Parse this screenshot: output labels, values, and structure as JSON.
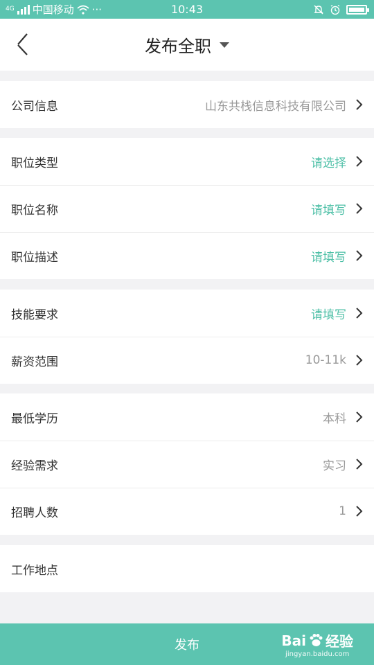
{
  "status": {
    "carrier": "中国移动",
    "network": "4G",
    "dots": "···",
    "time": "10:43"
  },
  "header": {
    "title": "发布全职"
  },
  "sections": [
    {
      "rows": [
        {
          "label": "公司信息",
          "value": "山东共栈信息科技有限公司",
          "accent": false
        }
      ]
    },
    {
      "rows": [
        {
          "label": "职位类型",
          "value": "请选择",
          "accent": true
        },
        {
          "label": "职位名称",
          "value": "请填写",
          "accent": true
        },
        {
          "label": "职位描述",
          "value": "请填写",
          "accent": true
        }
      ]
    },
    {
      "rows": [
        {
          "label": "技能要求",
          "value": "请填写",
          "accent": true
        },
        {
          "label": "薪资范围",
          "value": "10-11k",
          "accent": false
        }
      ]
    },
    {
      "rows": [
        {
          "label": "最低学历",
          "value": "本科",
          "accent": false
        },
        {
          "label": "经验需求",
          "value": "实习",
          "accent": false
        },
        {
          "label": "招聘人数",
          "value": "1",
          "accent": false
        }
      ]
    },
    {
      "rows": [
        {
          "label": "工作地点",
          "value": "",
          "accent": false
        }
      ]
    }
  ],
  "footer": {
    "publish_label": "发布"
  },
  "watermark": {
    "brand": "Bai",
    "brand_tail": "经验",
    "url": "jingyan.baidu.com"
  },
  "colors": {
    "accent": "#4cbfa6",
    "bar": "#5cc4b0"
  }
}
